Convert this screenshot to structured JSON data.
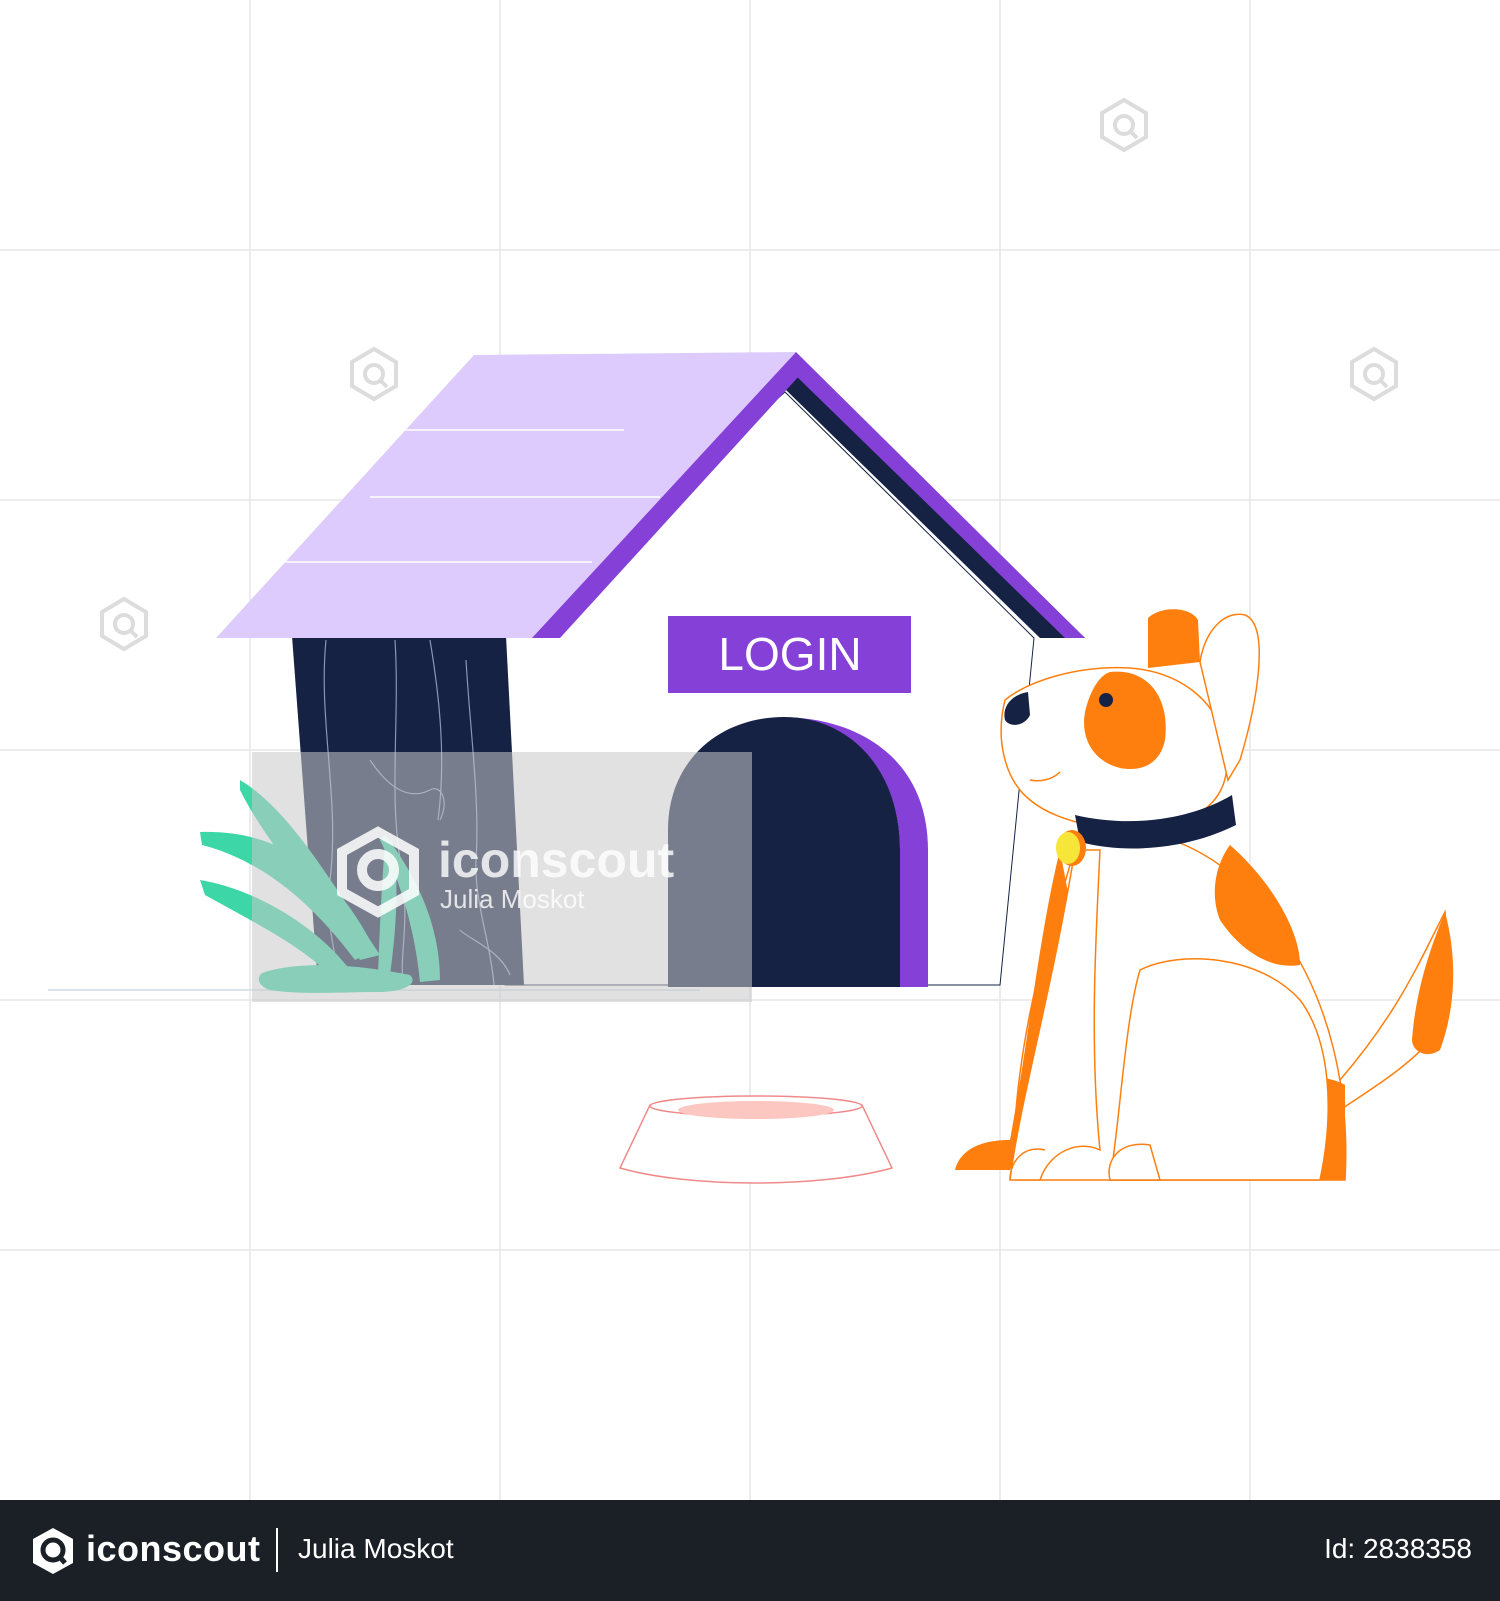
{
  "illustration": {
    "sign_text": "LOGIN",
    "watermark": {
      "brand": "iconscout",
      "author": "Julia Moskot"
    }
  },
  "footer": {
    "brand": "iconscout",
    "author": "Julia Moskot",
    "asset_id": "Id: 2838358"
  },
  "colors": {
    "background": "#ffffff",
    "grid": "#e6e6ea",
    "roof": "#dccbfc",
    "purple": "#8540d8",
    "navy": "#152244",
    "dog_orange": "#ff7f0e",
    "plant_green": "#3dd6a6",
    "footer_bg": "#1b1f26"
  },
  "icons": [
    "iconscout-logo-icon"
  ]
}
